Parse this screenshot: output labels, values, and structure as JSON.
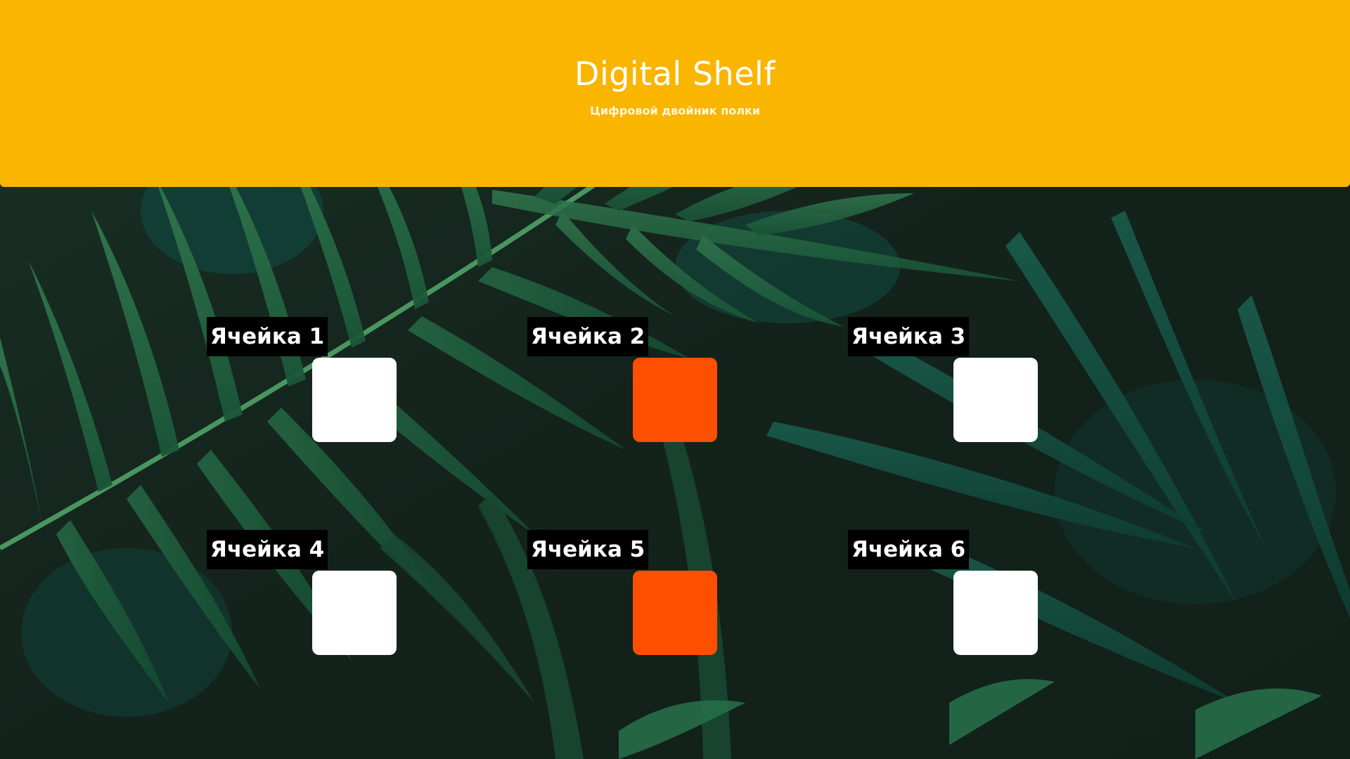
{
  "header": {
    "title": "Digital Shelf",
    "subtitle": "Цифровой двойник полки",
    "background_color": "#fab500"
  },
  "cells": [
    {
      "label": "Ячейка 1",
      "state_color": "#ffffff"
    },
    {
      "label": "Ячейка 2",
      "state_color": "#fd4f00"
    },
    {
      "label": "Ячейка 3",
      "state_color": "#ffffff"
    },
    {
      "label": "Ячейка 4",
      "state_color": "#ffffff"
    },
    {
      "label": "Ячейка 5",
      "state_color": "#fd4f00"
    },
    {
      "label": "Ячейка 6",
      "state_color": "#ffffff"
    }
  ],
  "colors": {
    "empty": "#ffffff",
    "occupied": "#fd4f00",
    "label_background": "#000000"
  }
}
